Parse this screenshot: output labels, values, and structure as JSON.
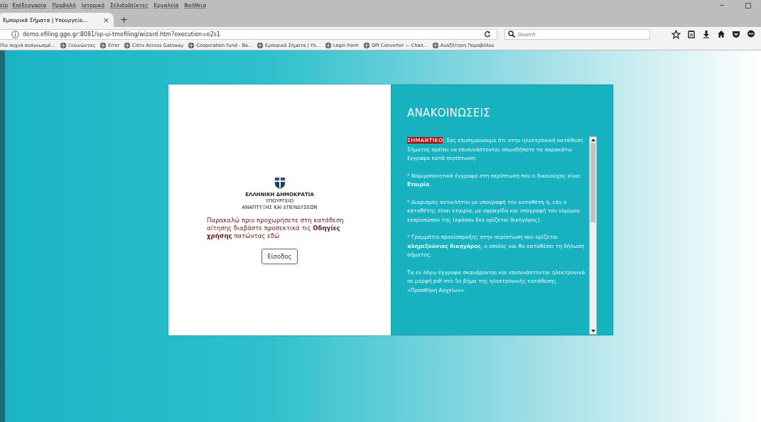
{
  "menu_bar": [
    "είο",
    "Επεξεργασία",
    "Προβολή",
    "Ιστορικό",
    "Σελιδοδείκτες",
    "Εργαλεία",
    "Βοήθεια"
  ],
  "tabs": [
    {
      "label": "Εμπορικά Σήματα | Υπουργείο...",
      "selected": true,
      "close": "×"
    }
  ],
  "new_tab": "+",
  "address": "demo.efiling.gge.gr:8081/sp-ui-tmefiling/wizard.htm?execution=e2s1",
  "search": {
    "placeholder": "Search"
  },
  "bookmarks": [
    "Πιο συχνά αναγνωσμέ...",
    "Ξεκινώντας",
    "Error",
    "Citrix Access Gateway",
    "Cooperation Fund - Ba...",
    "Εμπορικά Σήματα | Υπ...",
    "Login Form",
    "DPI Converter — Chan...",
    "Αναζήτηση Παραβόλου"
  ],
  "login_panel": {
    "emblem_lines": [
      "ΕΛΛΗΝΙΚΗ ΔΗΜΟΚΡΑΤΙΑ",
      "ΥΠΟΥΡΓΕΙΟ",
      "ΑΝΑΠΤΥΞΗΣ ΚΑΙ ΕΠΕΝΔΥΣΕΩΝ"
    ],
    "intro": "Παρακαλώ πριν προχωρήσετε στη κατάθεση αίτησης διαβάστε προσεκτικά τις **Οδηγίες χρήσης** πατώντας εδώ",
    "button": "Είσοδος"
  },
  "announcements": {
    "title": "ΑΝΑΚΟΙΝΩΣΕΙΣ",
    "important_label": "ΣΗΜΑΝΤΙΚΟ",
    "paragraphs": [
      ": Σας επισημαίνουμε ότι στην ηλεκτρονική κατάθεση Σήματος πρέπει να επισυνάπτονται οπωσδήποτε τα παρακάτω έγγραφα κατά περίπτωση:",
      "* Νομιμοποιητικά έγγραφα στη περίπτωση που ο δικαιούχος είναι **Εταιρία**.",
      "* Διορισμός αντικλήτου με υπογραφή του καταθέτη ή, εάν ο καταθέτης είναι εταιρία, με σφραγίδα και υπογραφή του νομίμου εκπροσώπου της (εφόσον δεν ορίζεται δικηγόρος).",
      "* Γραμμάτιο προείσπραξης στην περίπτωση που ορίζεται **πληρεξούσιος δικηγόρος**, ο οποίος και θα καταθέσει τη δήλωση σήματος.",
      "Τα εν λόγω έγγραφα σκανάρονται και επισυνάπτονται ηλεκτρονικά σε μορφή pdf στο 5ο βήμα της ηλεκτρονικής κατάθεσης «Προσθήκη Αρχείων»."
    ]
  }
}
